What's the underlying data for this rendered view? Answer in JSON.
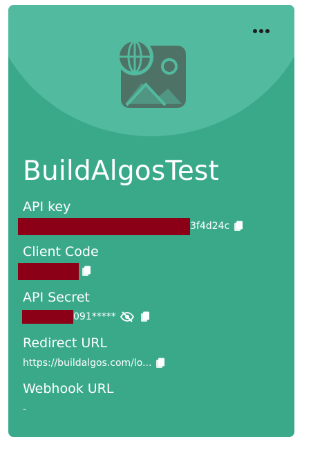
{
  "card": {
    "title": "BuildAlgosTest",
    "menu_icon": "more-horizontal-icon",
    "logo_icon": "globe-image-icon",
    "accent_color": "#3aa98a",
    "header_color": "#52ba9f",
    "redaction_color": "#8b0016"
  },
  "api_key": {
    "label": "API key",
    "value_suffix": "3f4d24c"
  },
  "client_code": {
    "label": "Client Code"
  },
  "api_secret": {
    "label": "API Secret",
    "value_suffix": "091*****"
  },
  "redirect_url": {
    "label": "Redirect URL",
    "value": "https://buildalgos.com/lo..."
  },
  "webhook_url": {
    "label": "Webhook URL",
    "value": "-"
  }
}
